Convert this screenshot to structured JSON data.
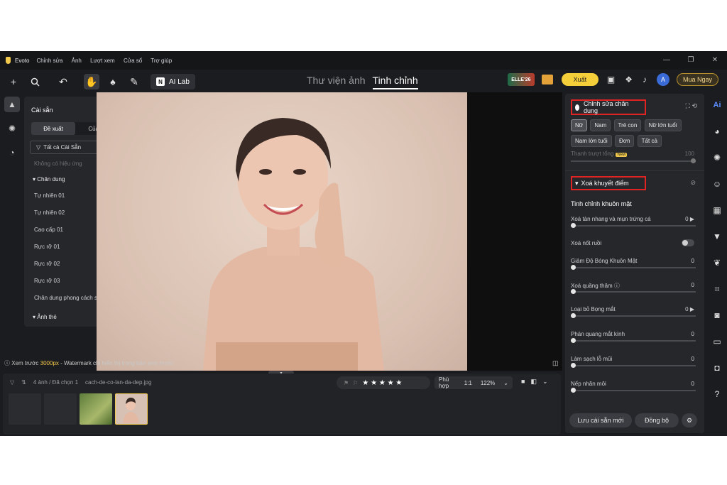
{
  "app": {
    "title": "Evoto",
    "menu": [
      "Chỉnh sửa",
      "Ảnh",
      "Lượt xem",
      "Cửa sổ",
      "Trợ giúp"
    ]
  },
  "window_controls": [
    "—",
    "❐",
    "✕"
  ],
  "toolbar": {
    "ai_lab": "AI Lab",
    "tabs": [
      "Thư viện ảnh",
      "Tinh chỉnh"
    ],
    "active_tab": "Tinh chỉnh",
    "promo_badge": "ELLE'26",
    "export": "Xuất",
    "avatar_letter": "A",
    "buy_now": "Mua Ngay",
    "undo_label": "↶"
  },
  "presets_panel": {
    "title": "Cài sẵn",
    "seg": [
      "Đề xuất",
      "Của tôi"
    ],
    "filter": "Tất cả Cài Sẵn",
    "empty_note": "Không có hiệu ứng",
    "group1": "Chân dung",
    "items": [
      "Tự nhiên 01",
      "Tự nhiên 02",
      "Cao cấp 01",
      "Rực rỡ 01",
      "Rực rỡ 02",
      "Rực rỡ 03",
      "Chân dung phong cách sống"
    ],
    "group2": "Ảnh thẻ"
  },
  "preview": {
    "label": "Xem trước",
    "resolution": "3000px",
    "rest": "- Watermark chỉ hiển thị trong bản xem trước"
  },
  "filmstrip": {
    "count": "4 ảnh / Đã chọn 1",
    "filename": "cach-de-co-lan-da-dep.jpg",
    "stars": "★ ★ ★ ★ ★",
    "fit": "Phù hợp",
    "ratio": "1:1",
    "zoom": "122%"
  },
  "right_panel": {
    "section1": "Chỉnh sửa chân dung",
    "chips": [
      "Nữ",
      "Nam",
      "Trẻ con",
      "Nữ lớn tuổi",
      "Nam lớn tuổi",
      "Đơn",
      "Tất cả"
    ],
    "active_chip": "Nữ",
    "intensity_label": "Thanh trượt tổng",
    "new_badge": "New",
    "intensity_value": "100",
    "section2": "Xoá khuyết điểm",
    "subsection": "Tinh chỉnh khuôn mặt",
    "sliders": [
      {
        "label": "Xoá tàn nhang và mụn trứng cá",
        "value": "0 ▶"
      },
      {
        "label": "Xoá nốt ruồi",
        "value": ""
      },
      {
        "label": "Giảm Độ Bóng Khuôn Mặt",
        "value": "0"
      },
      {
        "label": "Xoá quầng thâm ⓘ",
        "value": "0"
      },
      {
        "label": "Loại bỏ Bọng mắt",
        "value": "0 ▶"
      },
      {
        "label": "Phản quang mắt kính",
        "value": "0"
      },
      {
        "label": "Làm sạch lỗ mũi",
        "value": "0"
      },
      {
        "label": "Nếp nhăn môi",
        "value": "0"
      }
    ],
    "save_preset": "Lưu cài sẵn mới",
    "sync": "Đồng bộ"
  },
  "colors": {
    "accent_yellow": "#f5cf3a",
    "highlight_red": "#e02424",
    "bg": "#1b1c1f"
  },
  "icons": [
    "plus-icon",
    "search-icon",
    "undo-icon",
    "hand-icon",
    "brush-icon",
    "eraser-icon",
    "ai-icon",
    "palette-icon",
    "face-icon",
    "shirt-icon",
    "paw-icon",
    "crop-icon",
    "camera-icon",
    "help-icon"
  ]
}
